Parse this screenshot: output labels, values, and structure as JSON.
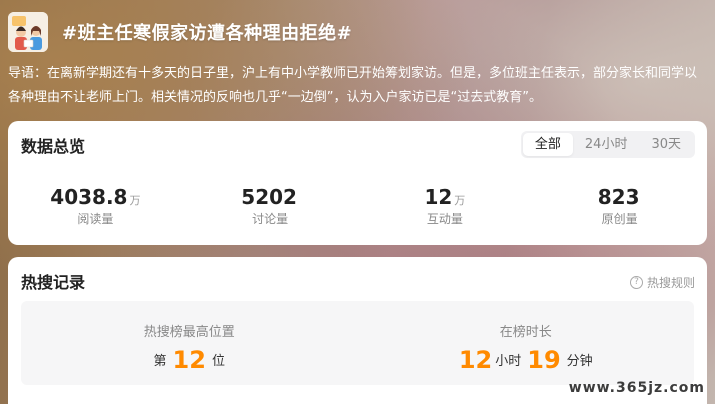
{
  "header": {
    "title": "#班主任寒假家访遭各种理由拒绝#"
  },
  "intro": "导语：在离新学期还有十多天的日子里，沪上有中小学教师已开始筹划家访。但是，多位班主任表示，部分家长和同学以各种理由不让老师上门。相关情况的反响也几乎“一边倒”，认为入户家访已是“过去式教育”。",
  "overview": {
    "title": "数据总览",
    "tabs": [
      {
        "label": "全部",
        "active": true
      },
      {
        "label": "24小时",
        "active": false
      },
      {
        "label": "30天",
        "active": false
      }
    ],
    "stats": [
      {
        "value": "4038.8",
        "unit": "万",
        "label": "阅读量"
      },
      {
        "value": "5202",
        "unit": "",
        "label": "讨论量"
      },
      {
        "value": "12",
        "unit": "万",
        "label": "互动量"
      },
      {
        "value": "823",
        "unit": "",
        "label": "原创量"
      }
    ]
  },
  "hotsearch": {
    "title": "热搜记录",
    "rules_label": "热搜规则",
    "rules_icon": "question-circle-icon",
    "peak": {
      "label": "热搜榜最高位置",
      "prefix": "第",
      "value": "12",
      "suffix": "位"
    },
    "duration": {
      "label": "在榜时长",
      "hours": "12",
      "hours_unit": "小时",
      "minutes": "19",
      "minutes_unit": "分钟"
    }
  },
  "watermark": "www.365jz.com",
  "colors": {
    "accent": "#ff8a00",
    "card": "#ffffff"
  }
}
